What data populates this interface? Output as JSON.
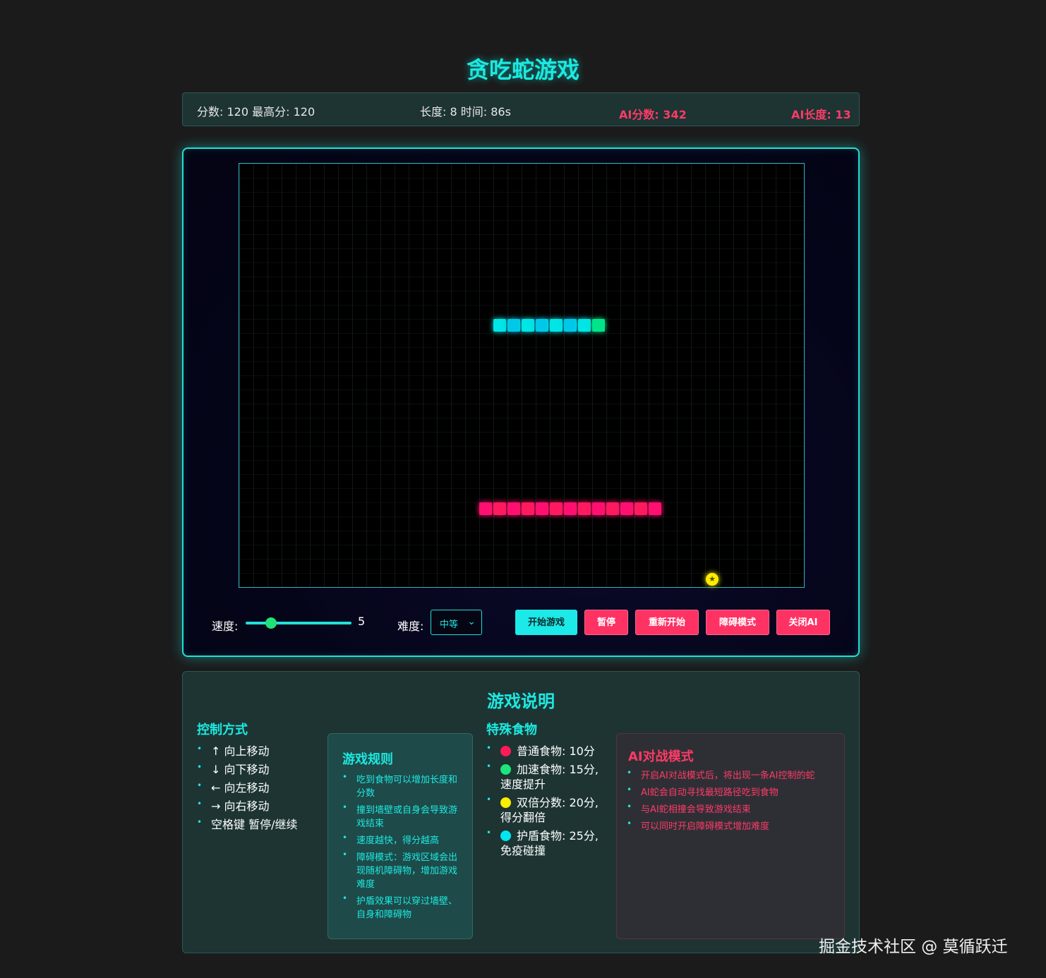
{
  "title": "贪吃蛇游戏",
  "stats": {
    "score": "分数: 120 最高分: 120",
    "length_time": "长度: 8 时间: 86s",
    "ai_score": "AI分数: 342",
    "ai_length": "AI长度: 13"
  },
  "game": {
    "player_snake_length": 8,
    "ai_snake_length": 13,
    "food_icon": "star-food-icon",
    "colors": {
      "player": "#00e5e5",
      "player_head": "#00e58a",
      "ai": "#ff1070",
      "food": "#ffee00",
      "accent": "#22e0d8"
    }
  },
  "controls_bar": {
    "speed_label": "速度:",
    "speed_value": "5",
    "difficulty_label": "难度:",
    "difficulty_selected": "中等",
    "start_button": "开始游戏",
    "pause_button": "暂停",
    "restart_button": "重新开始",
    "obstacle_button": "障碍模式",
    "ai_button": "关闭AI"
  },
  "info": {
    "title": "游戏说明",
    "controls": {
      "heading": "控制方式",
      "items": [
        "↑ 向上移动",
        "↓ 向下移动",
        "← 向左移动",
        "→ 向右移动",
        "空格键 暂停/继续"
      ]
    },
    "rules": {
      "heading": "游戏规则",
      "items": [
        "吃到食物可以增加长度和分数",
        "撞到墙壁或自身会导致游戏结束",
        "速度越快，得分越高",
        "障碍模式：游戏区域会出现随机障碍物，增加游戏难度",
        "护盾效果可以穿过墙壁、自身和障碍物"
      ]
    },
    "foods": {
      "heading": "特殊食物",
      "items": [
        {
          "text": "普通食物: 10分",
          "color": "#ff1a55"
        },
        {
          "text": "加速食物: 15分, 速度提升",
          "color": "#1de57a"
        },
        {
          "text": "双倍分数: 20分, 得分翻倍",
          "color": "#ffee00"
        },
        {
          "text": "护盾食物: 25分, 免疫碰撞",
          "color": "#00e5f0"
        }
      ]
    },
    "ai_mode": {
      "heading": "AI对战模式",
      "items": [
        "开启AI对战模式后，将出现一条AI控制的蛇",
        "AI蛇会自动寻找最短路径吃到食物",
        "与AI蛇相撞会导致游戏结束",
        "可以同时开启障碍模式增加难度"
      ]
    }
  },
  "watermark": "掘金技术社区 @ 莫循跃迁"
}
